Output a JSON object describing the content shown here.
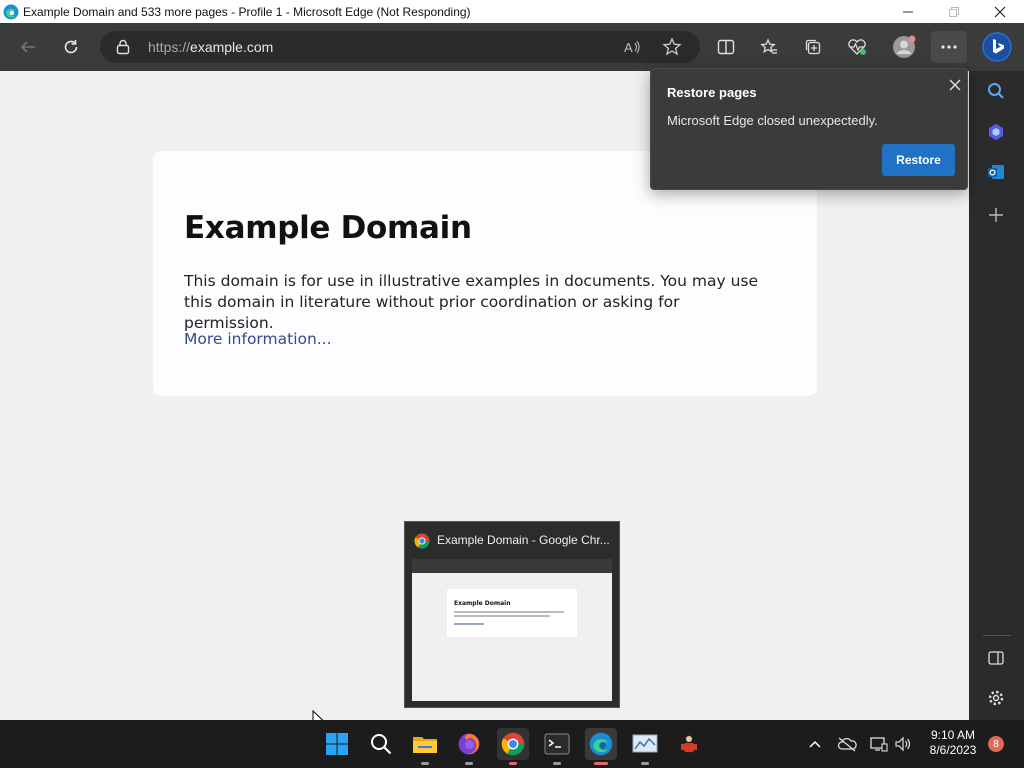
{
  "window": {
    "title": "Example Domain and 533 more pages - Profile 1 - Microsoft Edge (Not Responding)",
    "minimize_icon": "minimize-icon",
    "maximize_icon": "maximize-icon",
    "close_icon": "close-icon"
  },
  "toolbar": {
    "url_scheme": "https://",
    "url_host": "example.com"
  },
  "page": {
    "heading": "Example Domain",
    "body": "This domain is for use in illustrative examples in documents. You may use this domain in literature without prior coordination or asking for permission.",
    "link": "More information..."
  },
  "popup": {
    "title": "Restore pages",
    "message": "Microsoft Edge closed unexpectedly.",
    "restore_label": "Restore"
  },
  "thumbnail": {
    "title": "Example Domain - Google Chr...",
    "preview_heading": "Example Domain"
  },
  "taskbar": {
    "time": "9:10 AM",
    "date": "8/6/2023",
    "badge": "8"
  },
  "colors": {
    "accent": "#1f72c4",
    "toolbar": "#3b3b3b",
    "taskbar": "#1c1c1c"
  }
}
